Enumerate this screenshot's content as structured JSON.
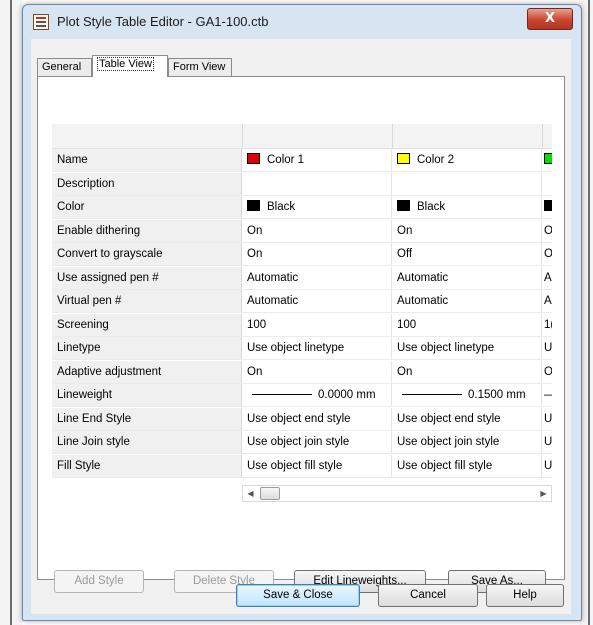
{
  "window": {
    "title": "Plot Style Table Editor - GA1-100.ctb",
    "close_glyph": "X"
  },
  "tabs": [
    {
      "label": "General"
    },
    {
      "label": "Table View"
    },
    {
      "label": "Form View"
    }
  ],
  "table": {
    "rows": [
      {
        "name": "Name",
        "c1": "Color 1",
        "c2": "Color 2",
        "c3": ""
      },
      {
        "name": "Description",
        "c1": "",
        "c2": "",
        "c3": ""
      },
      {
        "name": "Color",
        "c1": "Black",
        "c2": "Black",
        "c3": ""
      },
      {
        "name": "Enable dithering",
        "c1": "On",
        "c2": "On",
        "c3": "O"
      },
      {
        "name": "Convert to grayscale",
        "c1": "On",
        "c2": "Off",
        "c3": "O"
      },
      {
        "name": "Use assigned pen #",
        "c1": "Automatic",
        "c2": "Automatic",
        "c3": "A"
      },
      {
        "name": "Virtual pen #",
        "c1": "Automatic",
        "c2": "Automatic",
        "c3": "A"
      },
      {
        "name": "Screening",
        "c1": "100",
        "c2": "100",
        "c3": "1("
      },
      {
        "name": "Linetype",
        "c1": "Use object linetype",
        "c2": "Use object linetype",
        "c3": "U"
      },
      {
        "name": "Adaptive adjustment",
        "c1": "On",
        "c2": "On",
        "c3": "O"
      },
      {
        "name": "Lineweight",
        "c1": "0.0000 mm",
        "c2": "0.1500 mm",
        "c3": "—"
      },
      {
        "name": "Line End Style",
        "c1": "Use object end style",
        "c2": "Use object end style",
        "c3": "U"
      },
      {
        "name": "Line Join style",
        "c1": "Use object join style",
        "c2": "Use object join style",
        "c3": "U"
      },
      {
        "name": "Fill Style",
        "c1": "Use object fill style",
        "c2": "Use object fill style",
        "c3": "U"
      }
    ],
    "swatches": {
      "name_c1": "#e00000",
      "name_c2": "#ffff00",
      "name_c3": "#00e000",
      "color_black": "#000000"
    }
  },
  "buttons": {
    "add_style": "Add Style",
    "delete_style": "Delete Style",
    "edit_lineweights": "Edit Lineweights...",
    "save_as": "Save As...",
    "save_close": "Save & Close",
    "cancel": "Cancel",
    "help": "Help"
  }
}
